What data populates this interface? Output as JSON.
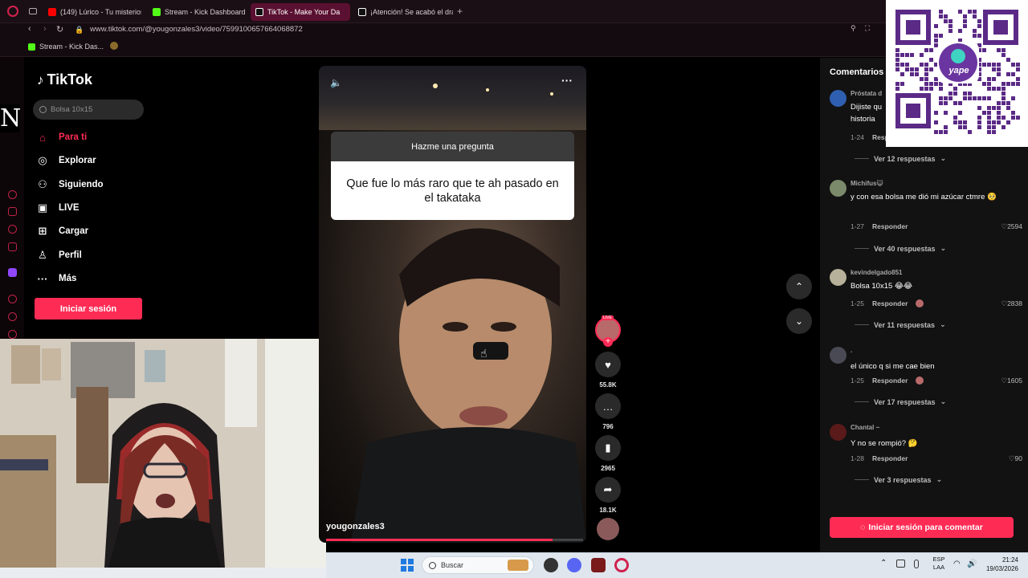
{
  "browser": {
    "tabs": [
      {
        "label": "(149) Lúrico - Tu misterios",
        "color": "#ff0000"
      },
      {
        "label": "Stream - Kick Dashboard",
        "color": "#53fc18"
      },
      {
        "label": "TikTok - Make Your Da",
        "color": "#ffffff"
      },
      {
        "label": "¡Atención! Se acabó el dra",
        "color": "#ffffff"
      }
    ],
    "url": "www.tiktok.com/@yougonzales3/video/7599100657664068872",
    "bookmarks": [
      {
        "label": "Stream - Kick Das..."
      }
    ]
  },
  "tiktok": {
    "logo": "TikTok",
    "search_placeholder": "Bolsa 10x15",
    "nav": [
      {
        "label": "Para ti",
        "icon": "home-icon",
        "active": true
      },
      {
        "label": "Explorar",
        "icon": "compass-icon"
      },
      {
        "label": "Siguiendo",
        "icon": "following-icon"
      },
      {
        "label": "LIVE",
        "icon": "live-icon"
      },
      {
        "label": "Cargar",
        "icon": "upload-icon"
      },
      {
        "label": "Perfil",
        "icon": "profile-icon"
      },
      {
        "label": "Más",
        "icon": "more-icon"
      }
    ],
    "login_label": "Iniciar sesión"
  },
  "overlay_letter": "N",
  "video": {
    "question_header": "Hazme una pregunta",
    "question_text": "Que fue lo más raro que te ah pasado en el takataka",
    "username": "yougonzales3",
    "progress": 0.88,
    "live_badge": "LIVE",
    "likes": "55.8K",
    "comments": "796",
    "saves": "2965",
    "shares": "18.1K"
  },
  "comments": {
    "title": "Comentarios",
    "items": [
      {
        "user": "Próstata d",
        "text": "Dijiste qu historia",
        "date": "1-24",
        "reply": "Resp",
        "likes": "",
        "more": "Ver 12 respuestas",
        "avatar_color": "#2f5fb0"
      },
      {
        "user": "Michifus😺",
        "text": "y con esa bolsa me dió mi azúcar ctmre 🥺",
        "date": "1-27",
        "reply": "Responder",
        "likes": "2594",
        "more": "Ver 40 respuestas",
        "avatar_color": "#7a8a6a"
      },
      {
        "user": "kevindelgado851",
        "text": "Bolsa 10x15 😂😂",
        "date": "1-25",
        "reply": "Responder",
        "likes": "2838",
        "more": "Ver 11 respuestas",
        "avatar_color": "#b7b09a"
      },
      {
        "user": ".",
        "text": "el único q si me cae bien",
        "date": "1-25",
        "reply": "Responder",
        "likes": "1605",
        "more": "Ver 17 respuestas",
        "avatar_color": "#4a4a55"
      },
      {
        "user": "Chantal ~",
        "text": "Y no se rompió? 🤔",
        "date": "1-28",
        "reply": "Responder",
        "likes": "90",
        "more": "Ver 3 respuestas",
        "avatar_color": "#5a1a1a"
      }
    ],
    "login_label": "Iniciar sesión para comentar"
  },
  "qr": {
    "brand": "yape"
  },
  "taskbar": {
    "search_label": "Buscar",
    "lang": "ESP",
    "lang_sub": "LAA",
    "time": "21:24",
    "date": "19/03/2026"
  }
}
